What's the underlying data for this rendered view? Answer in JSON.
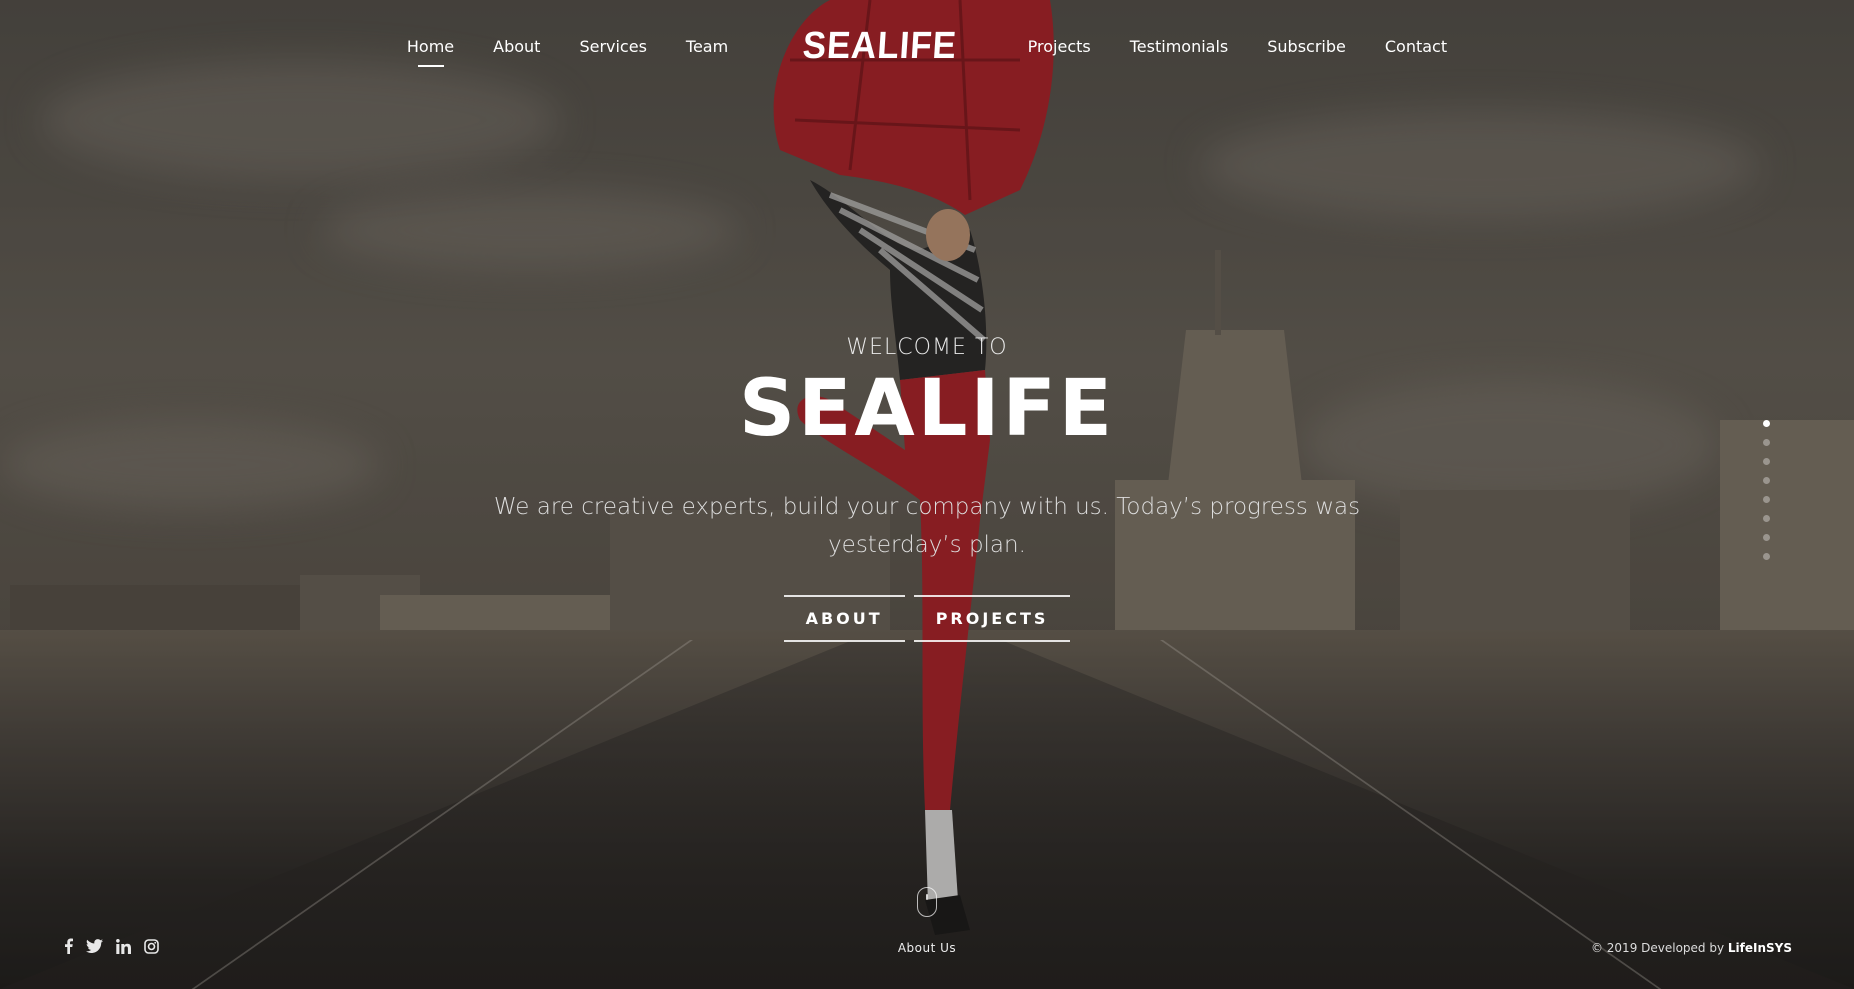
{
  "nav": {
    "left_items": [
      {
        "label": "Home",
        "active": true
      },
      {
        "label": "About",
        "active": false
      },
      {
        "label": "Services",
        "active": false
      },
      {
        "label": "Team",
        "active": false
      }
    ],
    "brand": "SEALIFE",
    "right_items": [
      {
        "label": "Projects",
        "active": false
      },
      {
        "label": "Testimonials",
        "active": false
      },
      {
        "label": "Subscribe",
        "active": false
      },
      {
        "label": "Contact",
        "active": false
      }
    ]
  },
  "hero": {
    "welcome": "WELCOME TO",
    "title": "SEALIFE",
    "tagline": "We are creative experts, build your company with us. Today’s progress was yesterday’s plan.",
    "buttons": [
      {
        "label": "ABOUT"
      },
      {
        "label": "PROJECTS"
      }
    ]
  },
  "section_dots": {
    "count": 8,
    "active_index": 0
  },
  "footer": {
    "scroll_label": "About Us",
    "social_icons": [
      "facebook-icon",
      "twitter-icon",
      "linkedin-icon",
      "instagram-icon"
    ],
    "credit_prefix": "© 2019 Developed by ",
    "credit_name": "LifeInSYS"
  },
  "colors": {
    "text": "#ffffff",
    "overlay": "#141210",
    "accent_red": "#b3222a"
  }
}
